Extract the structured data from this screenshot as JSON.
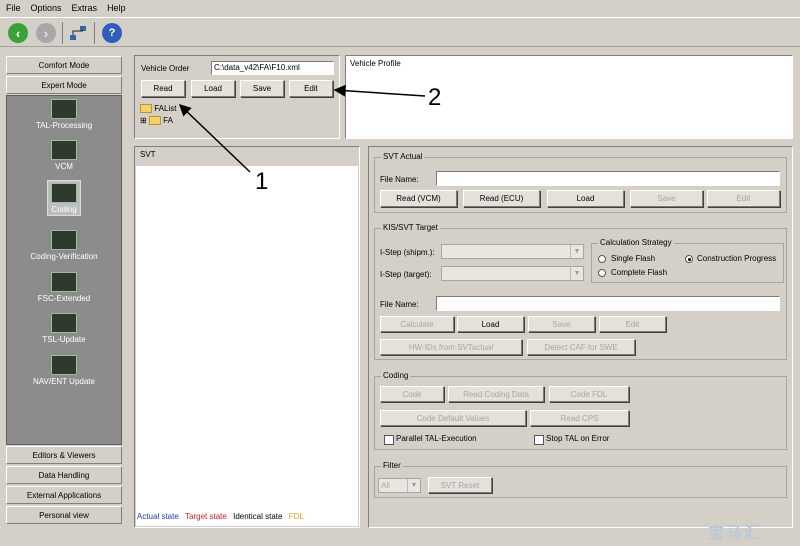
{
  "menu": [
    "File",
    "Options",
    "Extras",
    "Help"
  ],
  "toolbar": {
    "icons": [
      "back-icon",
      "forward-icon",
      "network-icon",
      "help-icon"
    ]
  },
  "sidebar": {
    "comfort_mode": "Comfort Mode",
    "expert_mode": "Expert Mode",
    "items": [
      "TAL-Processing",
      "VCM",
      "Coding",
      "Coding-Verification",
      "FSC-Extended",
      "TSL-Update",
      "NAV/ENT Update"
    ],
    "selected": "Coding",
    "bottom": [
      "Editors & Viewers",
      "Data Handling",
      "External Applications",
      "Personal view"
    ]
  },
  "vehicle_order": {
    "label": "Vehicle Order",
    "path": "C:\\data_v42\\FA\\F10.xml",
    "buttons": [
      "Read",
      "Load",
      "Save",
      "Edit"
    ],
    "tree": [
      "FAList",
      "FA"
    ]
  },
  "vehicle_profile": {
    "title": "Vehicle Profile"
  },
  "svt": {
    "title": "SVT"
  },
  "legend": [
    {
      "label": "Actual state",
      "color": "#1f3fbf"
    },
    {
      "label": "Target state",
      "color": "#d02020"
    },
    {
      "label": "Identical state",
      "color": "#000000"
    },
    {
      "label": "FDL",
      "color": "#e0a020"
    }
  ],
  "svt_actual": {
    "title": "SVT Actual",
    "file_name_label": "File Name:",
    "buttons": [
      "Read (VCM)",
      "Read (ECU)",
      "Load",
      "Save",
      "Edit"
    ]
  },
  "kis_target": {
    "title": "KIS/SVT Target",
    "istep_shipm": "I-Step (shipm.):",
    "istep_target": "I-Step (target):",
    "strategy_title": "Calculation Strategy",
    "single_flash": "Single Flash",
    "complete_flash": "Complete Flash",
    "construction_progress": "Construction Progress",
    "file_name_label": "File Name:",
    "buttons": [
      "Calculate",
      "Load",
      "Save",
      "Edit"
    ],
    "hw_ids": "HW-IDs from SVTactual",
    "detect_caf": "Detect CAF for SWE"
  },
  "coding": {
    "title": "Coding",
    "code": "Code",
    "read_coding_data": "Read Coding Data",
    "code_fdl": "Code FDL",
    "code_default": "Code Default Values",
    "read_cps": "Read CPS",
    "parallel_tal": "Parallel TAL-Execution",
    "stop_tal": "Stop TAL on Error"
  },
  "filter": {
    "title": "Filter",
    "value": "All",
    "reset": "SVT Reset"
  },
  "annotations": [
    "1",
    "2"
  ],
  "watermark": "宝马汇"
}
